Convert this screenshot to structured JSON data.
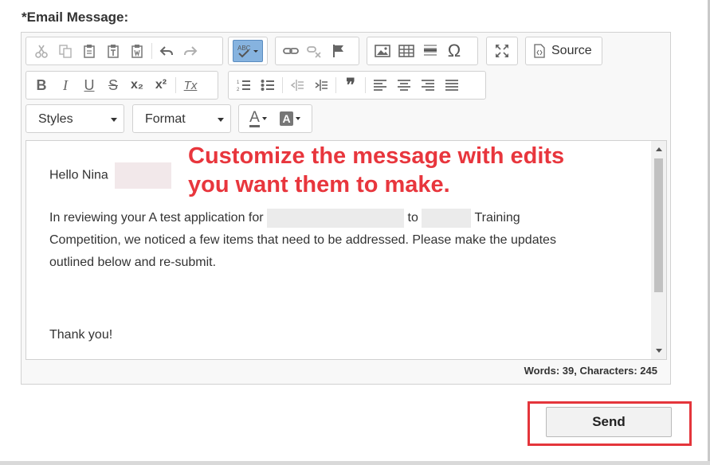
{
  "field": {
    "label": "*Email Message:"
  },
  "toolbar": {
    "row1": {
      "clipboard": [
        "cut-icon",
        "copy-icon",
        "paste-icon",
        "paste-text-icon",
        "paste-word-icon"
      ],
      "history": [
        "undo-icon",
        "redo-icon"
      ],
      "spellcheck": "spellcheck-icon",
      "links": [
        "link-icon",
        "unlink-icon",
        "anchor-icon"
      ],
      "insert": [
        "image-icon",
        "table-icon",
        "horizontal-line-icon",
        "special-char-icon"
      ],
      "maximize": "maximize-icon",
      "source_label": "Source"
    },
    "row2": {
      "basic": [
        "bold-icon",
        "italic-icon",
        "underline-icon",
        "strike-icon",
        "subscript-icon",
        "superscript-icon",
        "remove-format-icon"
      ],
      "paragraph": [
        "numbered-list-icon",
        "bulleted-list-icon",
        "outdent-icon",
        "indent-icon",
        "blockquote-icon"
      ],
      "align": [
        "align-left-icon",
        "align-center-icon",
        "align-right-icon",
        "justify-icon"
      ],
      "glyphs": {
        "bold": "B",
        "italic": "I",
        "underline": "U",
        "strike": "S",
        "subscript": "x₂",
        "superscript": "x²",
        "remove": "Tx",
        "quote": "❞",
        "omega": "Ω",
        "spell": "ABC"
      }
    },
    "row3": {
      "styles_label": "Styles",
      "format_label": "Format",
      "text_color_letter": "A",
      "bg_color_letter": "A"
    }
  },
  "body": {
    "greeting": "Hello Nina",
    "line1_a": "In reviewing your A test application for",
    "line1_b": "to",
    "line1_c": "Training",
    "line2": "Competition, we noticed a few items that need to be addressed. Please make the updates",
    "line3": "outlined below and re-submit.",
    "signoff": "Thank you!"
  },
  "annotation": {
    "line1": "Customize the message with edits",
    "line2": "you want them to make.",
    "color": "#e8363d"
  },
  "status": {
    "counter": "Words: 39, Characters: 245"
  },
  "actions": {
    "send_label": "Send",
    "highlight_color": "#e4353b"
  },
  "colors": {
    "accent": "#86b3df",
    "icon": "#555555",
    "disabled_icon": "#b0b0b0"
  }
}
